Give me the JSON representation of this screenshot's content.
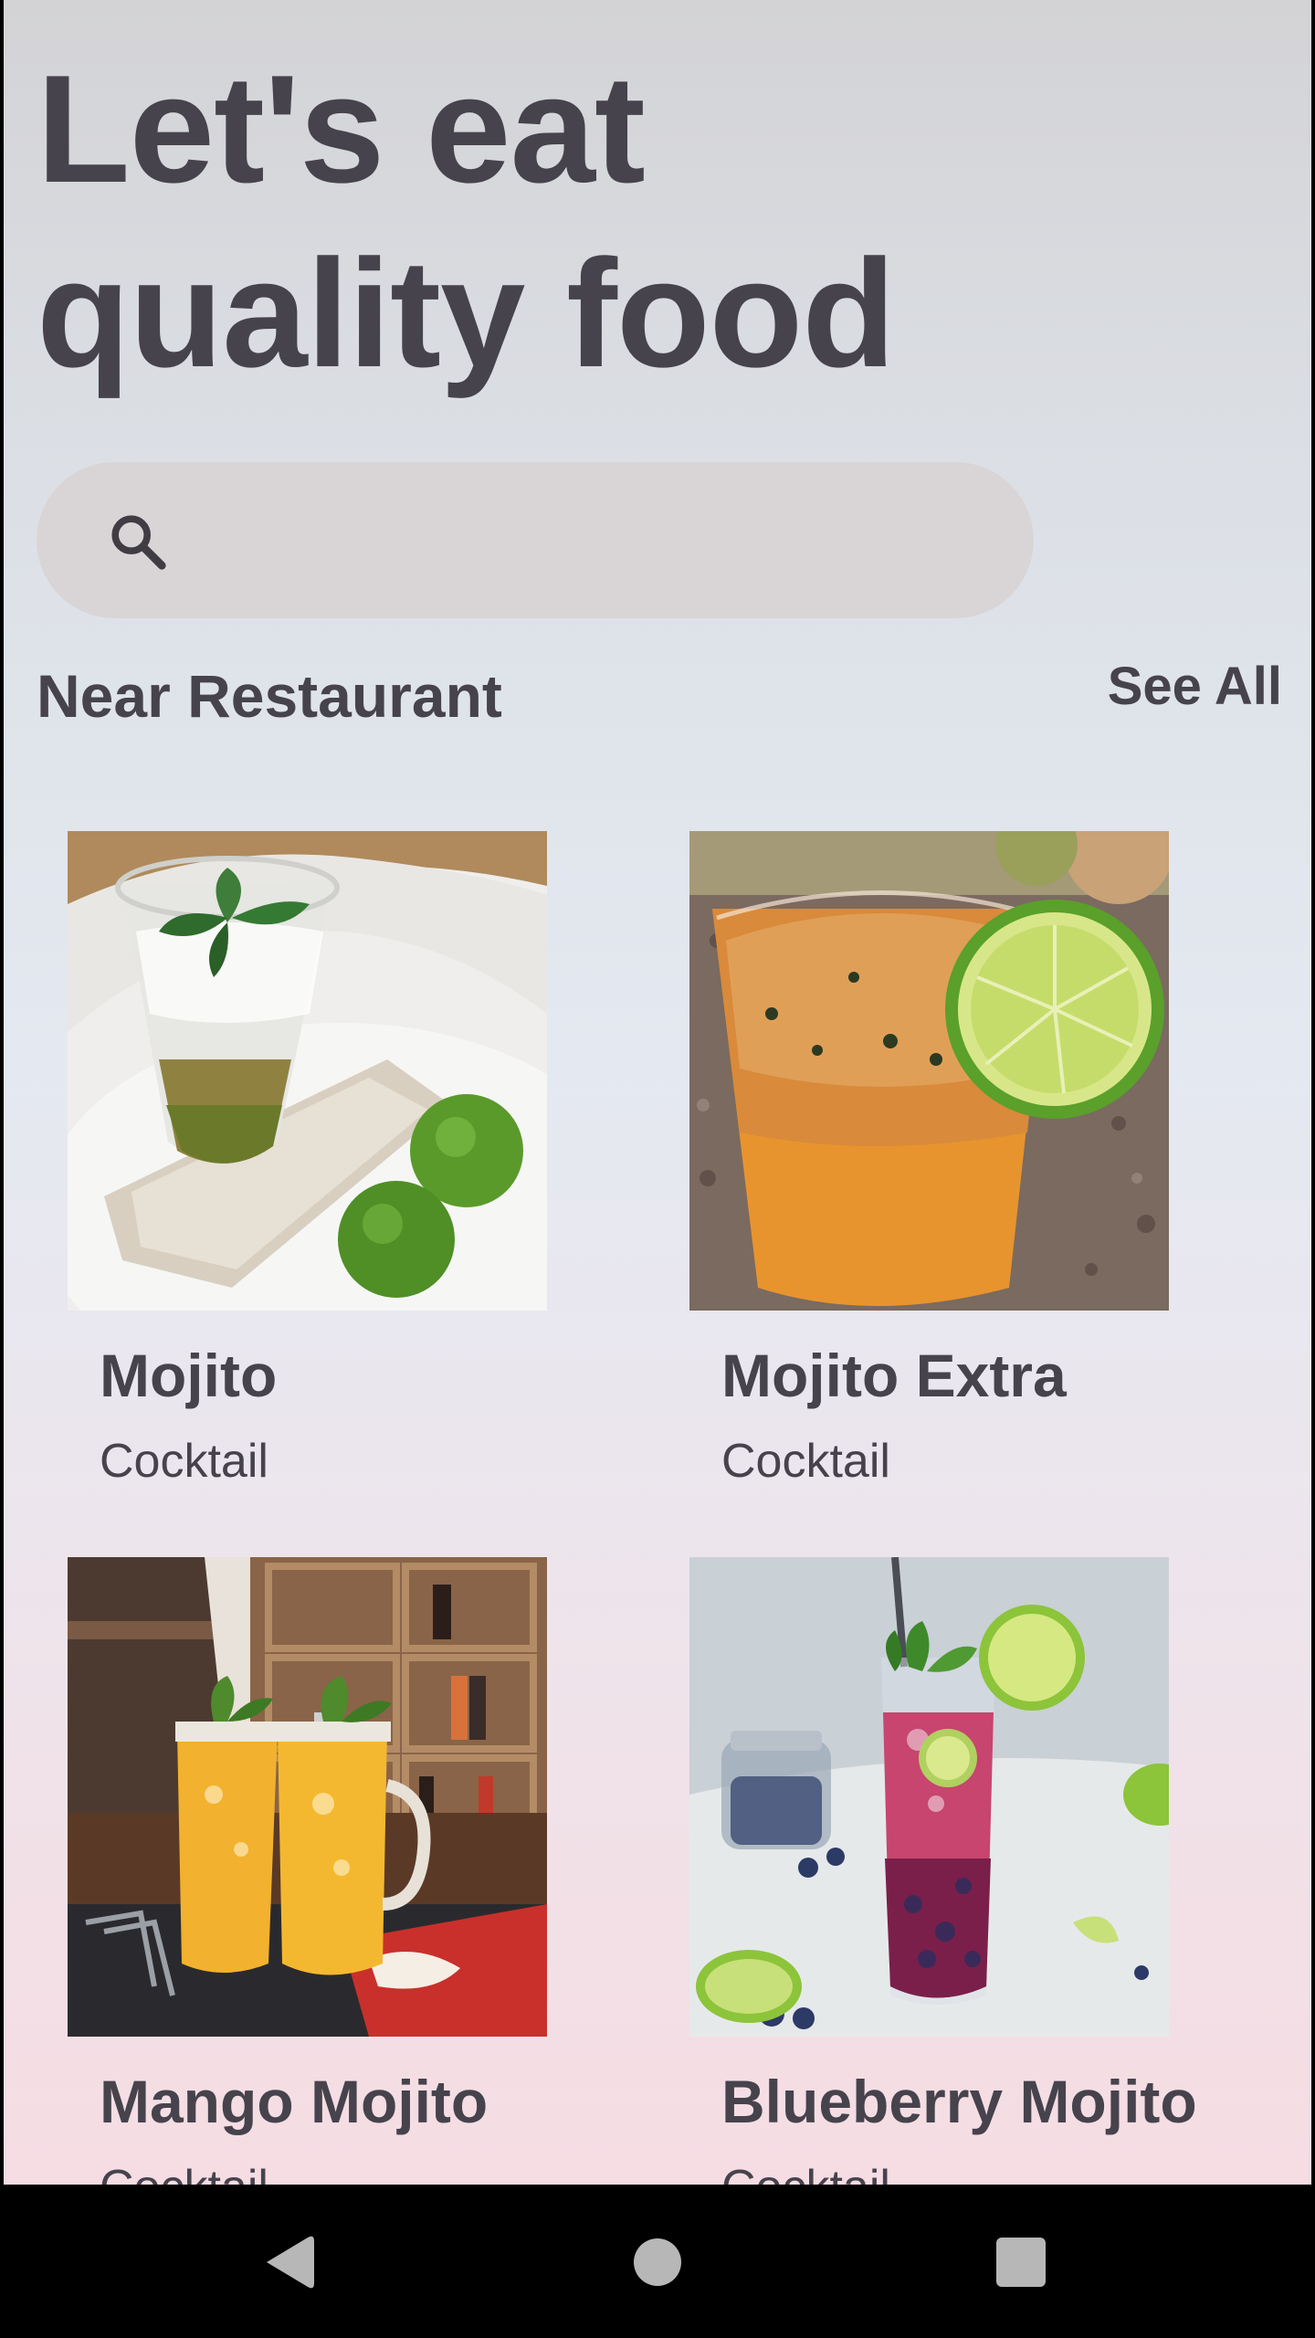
{
  "header": {
    "title_line1": "Let's eat",
    "title_line2": "quality food"
  },
  "search": {
    "icon": "search-icon",
    "value": ""
  },
  "section": {
    "title": "Near Restaurant",
    "see_all_label": "See All"
  },
  "items": [
    {
      "name": "Mojito",
      "category": "Cocktail",
      "image": "mojito-photo"
    },
    {
      "name": "Mojito Extra",
      "category": "Cocktail",
      "image": "mojito-extra-photo"
    },
    {
      "name": "Mango Mojito",
      "category": "Cocktail",
      "image": "mango-mojito-photo"
    },
    {
      "name": "Blueberry Mojito",
      "category": "Cocktail",
      "image": "blueberry-mojito-photo"
    }
  ],
  "navigation": {
    "back": "back-icon",
    "home": "home-icon",
    "recents": "recents-icon"
  },
  "colors": {
    "text": "#46434c",
    "search_bg": "#d9d5d6",
    "lime": "#6fae3a"
  }
}
